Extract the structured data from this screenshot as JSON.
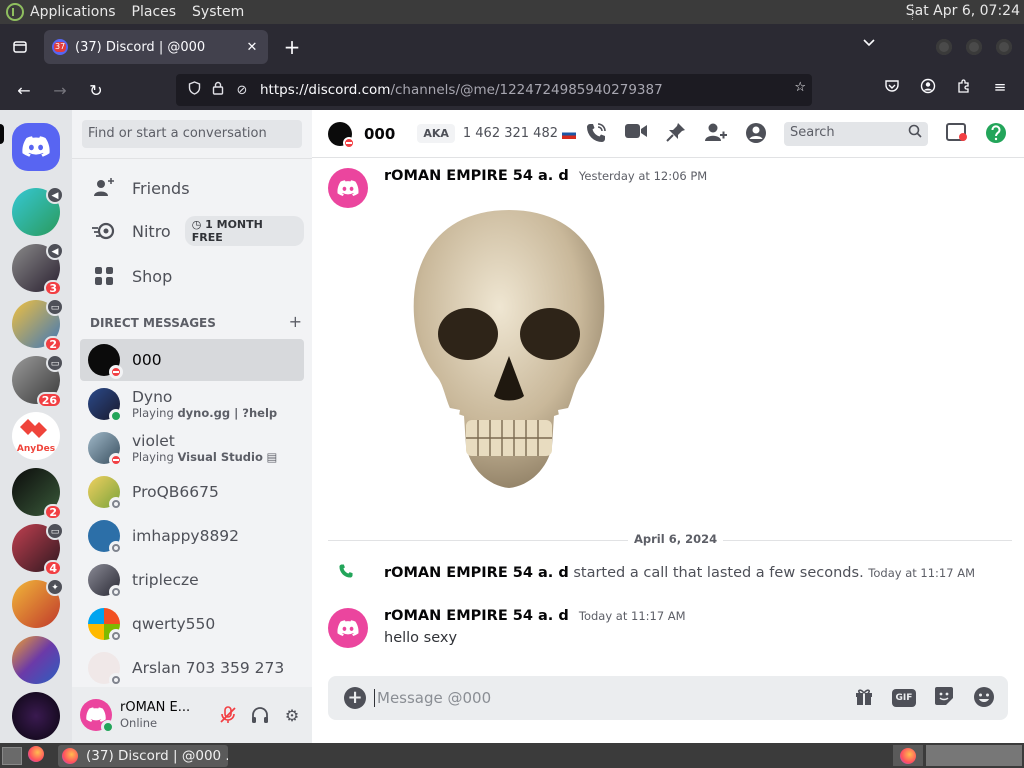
{
  "os_panel": {
    "menus": [
      "Applications",
      "Places",
      "System"
    ],
    "clock": "Sat Apr  6, 07:24"
  },
  "browser": {
    "tab": {
      "badge": "37",
      "title": "(37) Discord | @000"
    },
    "url_host": "https://discord.com",
    "url_path": "/channels/@me/1224724985940279387"
  },
  "guilds": [
    {
      "icon": "discord-home-icon",
      "color": "#5865f2"
    },
    {
      "icon": "server-icon",
      "color": "#36c8d4",
      "has_voice": true
    },
    {
      "icon": "server-icon",
      "color": "#5a4b6e",
      "badge": "3",
      "has_voice": true
    },
    {
      "icon": "server-icon",
      "color": "#3f77b8",
      "badge": "2",
      "has_stream": true
    },
    {
      "icon": "server-icon",
      "color": "#4b4b4b",
      "badge": "26",
      "has_stream": true
    },
    {
      "icon": "anydesk-icon",
      "color": "#ef443b",
      "label": "AnyDes"
    },
    {
      "icon": "server-icon",
      "color": "#1f2a3a",
      "badge": "2"
    },
    {
      "icon": "server-icon",
      "color": "#8a2d3b",
      "badge": "4",
      "has_stream": true
    },
    {
      "icon": "server-icon",
      "color": "#f1b73a",
      "has_stream": true
    },
    {
      "icon": "server-icon",
      "color": "#6b3aa8"
    },
    {
      "icon": "server-icon",
      "color": "#1a0d24"
    }
  ],
  "sidebar": {
    "search_placeholder": "Find or start a conversation",
    "nav": [
      {
        "label": "Friends",
        "icon": "friends-icon"
      },
      {
        "label": "Nitro",
        "icon": "nitro-icon",
        "promo": "1 MONTH FREE"
      },
      {
        "label": "Shop",
        "icon": "shop-icon"
      }
    ],
    "dm_header": "DIRECT MESSAGES",
    "dms": [
      {
        "name": "000",
        "status": "dnd",
        "color": "#0b0b0b",
        "active": true
      },
      {
        "name": "Dyno",
        "status": "on",
        "color": "#2b4a8a",
        "activity_prefix": "Playing",
        "activity": "dyno.gg | ?help"
      },
      {
        "name": "violet",
        "status": "dnd",
        "color": "#6b8a9a",
        "activity_prefix": "Playing",
        "activity": "Visual Studio"
      },
      {
        "name": "ProQB6675",
        "status": "off",
        "color": "#7aa33b"
      },
      {
        "name": "imhappy8892",
        "status": "off",
        "color": "#2c6fa8"
      },
      {
        "name": "triplecze",
        "status": "off",
        "color": "#4a4a55"
      },
      {
        "name": "qwerty550",
        "status": "off",
        "color": "#3a9ad9"
      },
      {
        "name": "Arslan 703 359 273",
        "status": "off",
        "color": "#f0e8e8"
      }
    ]
  },
  "user_panel": {
    "name": "rOMAN E...",
    "status": "Online"
  },
  "chat": {
    "title": "000",
    "aka": "AKA",
    "aka_names": "1 462 321 482",
    "search_placeholder": "Search",
    "messages": [
      {
        "author": "rOMAN EMPIRE 54 a. d",
        "time": "Yesterday at 12:06 PM",
        "attachment": "skull-image"
      },
      {
        "divider": "April 6, 2024"
      },
      {
        "author": "rOMAN EMPIRE 54 a. d",
        "system_text": "started a call that lasted a few seconds.",
        "time": "Today at 11:17 AM"
      },
      {
        "author": "rOMAN EMPIRE 54 a. d",
        "time": "Today at 11:17 AM",
        "text": "hello sexy"
      }
    ],
    "composer_placeholder": "Message @000",
    "gif_label": "GIF"
  },
  "taskbar": {
    "window_title": "(37) Discord | @000 ..."
  },
  "colors": {
    "blurple": "#5865f2",
    "pink": "#eb459e",
    "dnd": "#f23f43",
    "online": "#23a55a"
  }
}
